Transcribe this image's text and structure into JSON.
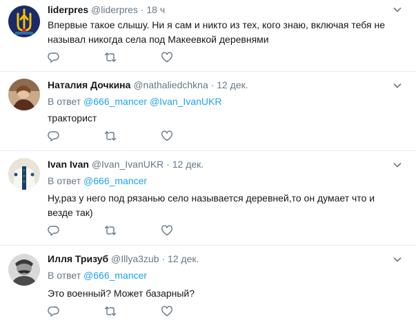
{
  "tweets": [
    {
      "name": "liderpres",
      "handle": "@liderpres",
      "sep": "·",
      "time": "18 ч",
      "reply_prefix": "",
      "mentions": [],
      "text": "Впервые такое слышу. Ни я сам и никто из тех, кого знаю, включая тебя не называл никогда села под Макеевкой деревнями",
      "avatar": "trident-emblem"
    },
    {
      "name": "Наталия Дочкина",
      "handle": "@nathaliedchkna",
      "sep": "·",
      "time": "12 дек.",
      "reply_prefix": "В ответ",
      "mentions": [
        "@666_mancer",
        "@Ivan_IvanUKR"
      ],
      "text": "тракторист",
      "avatar": "person-photo"
    },
    {
      "name": "Ivan Ivan",
      "handle": "@Ivan_IvanUKR",
      "sep": "·",
      "time": "12 дек.",
      "reply_prefix": "В ответ",
      "mentions": [
        "@666_mancer"
      ],
      "text": "Ну,раз у него под рязанью село называется деревней,то он думает что и везде так)",
      "avatar": "embroidered-shirt"
    },
    {
      "name": "Илля Тризуб",
      "handle": "@Illya3zub",
      "sep": "·",
      "time": "12 дек.",
      "reply_prefix": "В ответ",
      "mentions": [
        "@666_mancer"
      ],
      "text": "Это военный? Может базарный?",
      "avatar": "mustached-portrait"
    }
  ],
  "colors": {
    "accent": "#1da1f2",
    "secondary_text": "#657786",
    "icon": "#657786",
    "divider": "#e6ecf0"
  },
  "icons": {
    "reply": "reply-icon",
    "retweet": "retweet-icon",
    "like": "heart-icon",
    "menu": "chevron-down-icon"
  }
}
